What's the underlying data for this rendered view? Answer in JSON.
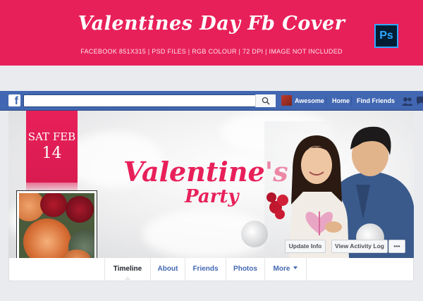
{
  "banner": {
    "title": "Valentines Day Fb Cover",
    "subtitle": "FACEBOOK  851X315 | PSD FILES | RGB COLOUR | 72 DPI | IMAGE NOT INCLUDED",
    "badge": "Ps",
    "accent": "#e8205a"
  },
  "topbar": {
    "logo": "f",
    "search_placeholder": "",
    "search_icon": "search-icon",
    "user_name": "Awesome",
    "home": "Home",
    "find_friends": "Find Friends",
    "icons": [
      "friend-requests-icon",
      "messages-icon"
    ],
    "bar_color": "#4267b2"
  },
  "cover": {
    "date_month": "SAT FEB",
    "date_day": "14",
    "title": "Valentine's",
    "subtitle": "Party",
    "buttons": {
      "update_info": "Update Info",
      "activity_log": "View Activity Log",
      "more": "•••"
    }
  },
  "nav": {
    "tabs": [
      {
        "label": "Timeline",
        "active": true
      },
      {
        "label": "About"
      },
      {
        "label": "Friends"
      },
      {
        "label": "Photos"
      },
      {
        "label": "More"
      }
    ]
  }
}
